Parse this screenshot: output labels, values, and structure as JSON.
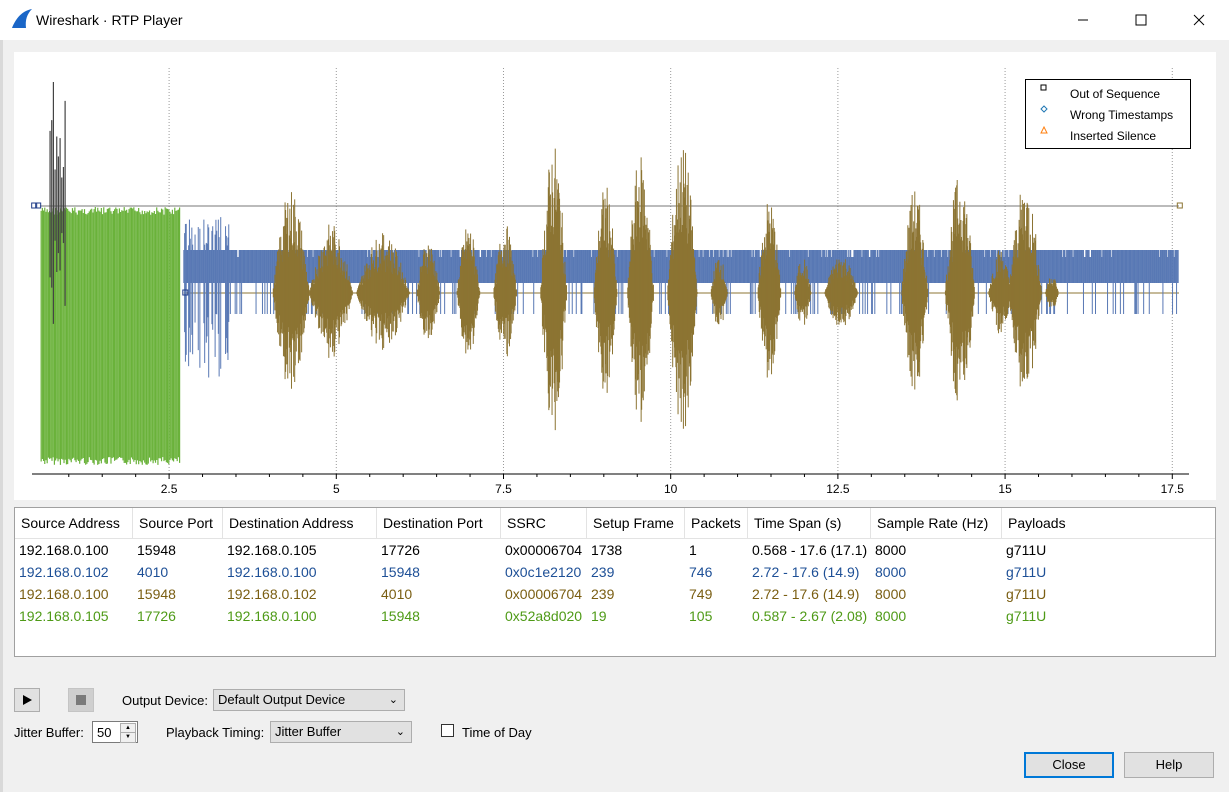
{
  "window": {
    "title": "Wireshark · RTP Player"
  },
  "legend": [
    {
      "label": "Out of Sequence",
      "marker": "square",
      "color": "#000000"
    },
    {
      "label": "Wrong Timestamps",
      "marker": "diamond",
      "color": "#1f77b4"
    },
    {
      "label": "Inserted Silence",
      "marker": "triangle",
      "color": "#ff7f0e"
    }
  ],
  "chart_data": {
    "type": "line",
    "x_ticks": [
      "2.5",
      "5",
      "7.5",
      "10",
      "12.5",
      "15",
      "17.5"
    ],
    "x_tick_values": [
      2.5,
      5,
      7.5,
      10,
      12.5,
      15,
      17.5
    ],
    "xlim": [
      0.45,
      17.75
    ],
    "grid": "vertical",
    "series": [
      {
        "name": "192.168.0.100:15948 → 192.168.0.105:17726",
        "color": "#444444",
        "x_range": [
          0.568,
          17.6
        ]
      },
      {
        "name": "192.168.0.102:4010 → 192.168.0.100:15948",
        "color": "#5878b4",
        "x_range": [
          2.72,
          17.6
        ]
      },
      {
        "name": "192.168.0.100:15948 → 192.168.0.102:4010",
        "color": "#8c7433",
        "x_range": [
          2.72,
          17.6
        ]
      },
      {
        "name": "192.168.0.105:17726 → 192.168.0.100:15948",
        "color": "#6ab23a",
        "x_range": [
          0.587,
          2.67
        ]
      }
    ]
  },
  "table": {
    "columns": [
      "Source Address",
      "Source Port",
      "Destination Address",
      "Destination Port",
      "SSRC",
      "Setup Frame",
      "Packets",
      "Time Span (s)",
      "Sample Rate (Hz)",
      "Payloads"
    ],
    "rows": [
      {
        "color": "#000000",
        "cells": [
          "192.168.0.100",
          "15948",
          "192.168.0.105",
          "17726",
          "0x00006704",
          "1738",
          "1",
          "0.568 - 17.6 (17.1)",
          "8000",
          "g711U"
        ]
      },
      {
        "color": "#1d4f96",
        "cells": [
          "192.168.0.102",
          "4010",
          "192.168.0.100",
          "15948",
          "0x0c1e2120",
          "239",
          "746",
          "2.72 - 17.6 (14.9)",
          "8000",
          "g711U"
        ]
      },
      {
        "color": "#7a5e12",
        "cells": [
          "192.168.0.100",
          "15948",
          "192.168.0.102",
          "4010",
          "0x00006704",
          "239",
          "749",
          "2.72 - 17.6 (14.9)",
          "8000",
          "g711U"
        ]
      },
      {
        "color": "#4e9a16",
        "cells": [
          "192.168.0.105",
          "17726",
          "192.168.0.100",
          "15948",
          "0x52a8d020",
          "19",
          "105",
          "0.587 - 2.67 (2.08)",
          "8000",
          "g711U"
        ]
      }
    ]
  },
  "controls": {
    "output_device_label": "Output Device:",
    "output_device_value": "Default Output Device",
    "jitter_buffer_label": "Jitter Buffer:",
    "jitter_buffer_value": "50",
    "playback_timing_label": "Playback Timing:",
    "playback_timing_value": "Jitter Buffer",
    "time_of_day_label": "Time of Day",
    "time_of_day_checked": false
  },
  "buttons": {
    "close": "Close",
    "help": "Help"
  }
}
